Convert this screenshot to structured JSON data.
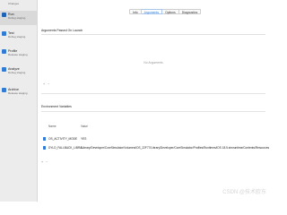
{
  "sidebar": {
    "top_item": {
      "subtitle": "Changes"
    },
    "items": [
      {
        "title": "Run",
        "subtitle": "Debug staging",
        "selected": true
      },
      {
        "title": "Test",
        "subtitle": "Debug staging",
        "selected": false
      },
      {
        "title": "Profile",
        "subtitle": "Release staging",
        "selected": false
      },
      {
        "title": "Analyze",
        "subtitle": "Debug staging",
        "selected": false
      },
      {
        "title": "Archive",
        "subtitle": "Release staging",
        "selected": false
      }
    ]
  },
  "tabs": [
    {
      "label": "Info",
      "active": false
    },
    {
      "label": "Arguments",
      "active": true
    },
    {
      "label": "Options",
      "active": false
    },
    {
      "label": "Diagnostics",
      "active": false
    }
  ],
  "arguments_section": {
    "title": "Arguments Passed On Launch",
    "empty_text": "No Arguments",
    "add_remove": "+ −"
  },
  "env_section": {
    "title": "Environment Variables",
    "columns": {
      "name": "Name",
      "value": "Value"
    },
    "rows": [
      {
        "name": "OS_ACTIVITY_MODE",
        "value": "YES",
        "enabled": true
      },
      {
        "name": "DYLD_FALLBACK_LIBRA...",
        "value": "/Library/Developer/CoreSimulator/Volumes/iOS_22F77/Library/Developer/CoreSimulator/Profiles/Runtimes/iOS 18.5.simruntime/Contents/Resources/RuntimeRoot/System/Cryptexes/OS/usr/lib/swift",
        "enabled": true
      }
    ],
    "add_remove": "+ −"
  },
  "colors": {
    "accent": "#2f7bd6",
    "sidebar_bg": "#ececec"
  },
  "watermark": "CSDN @技术欧东"
}
